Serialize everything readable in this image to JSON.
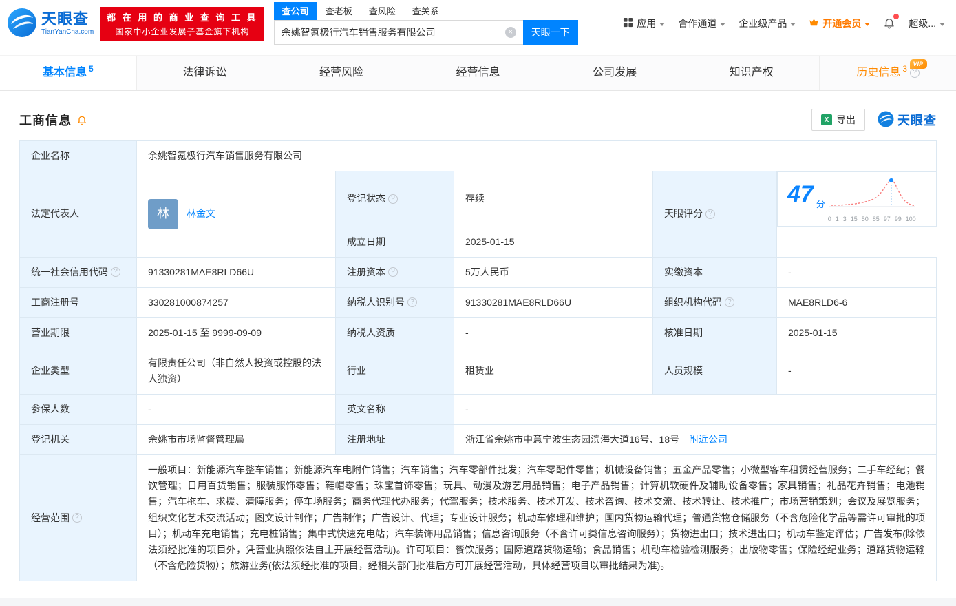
{
  "header": {
    "logo": {
      "title": "天眼查",
      "subtitle": "TianYanCha.com"
    },
    "slogan": {
      "line1": "都 在 用 的 商 业 查 询 工 具",
      "line2": "国家中小企业发展子基金旗下机构"
    },
    "search": {
      "tabs": [
        {
          "label": "查公司"
        },
        {
          "label": "查老板"
        },
        {
          "label": "查风险"
        },
        {
          "label": "查关系"
        }
      ],
      "input_value": "余姚智氪极行汽车销售服务有限公司",
      "button_label": "天眼一下"
    },
    "nav": {
      "apps": "应用",
      "partner": "合作通道",
      "enterprise": "企业级产品",
      "vip": "开通会员",
      "account": "超级..."
    }
  },
  "nav_tabs": [
    {
      "label": "基本信息",
      "count": "5"
    },
    {
      "label": "法律诉讼"
    },
    {
      "label": "经营风险"
    },
    {
      "label": "经营信息"
    },
    {
      "label": "公司发展"
    },
    {
      "label": "知识产权"
    },
    {
      "label": "历史信息",
      "count": "3",
      "vip_tag": "VIP"
    }
  ],
  "section": {
    "title": "工商信息",
    "export_label": "导出",
    "watermark": "天眼查"
  },
  "info": {
    "name_label": "企业名称",
    "name": "余姚智氪极行汽车销售服务有限公司",
    "legal_rep_label": "法定代表人",
    "legal_rep": "林金文",
    "legal_rep_avatar": "林",
    "reg_status_label": "登记状态",
    "reg_status": "存续",
    "score_label": "天眼评分",
    "score": "47",
    "score_unit": "分",
    "established_label": "成立日期",
    "established": "2025-01-15",
    "credit_code_label": "统一社会信用代码",
    "credit_code": "91330281MAE8RLD66U",
    "reg_capital_label": "注册资本",
    "reg_capital": "5万人民币",
    "paid_capital_label": "实缴资本",
    "paid_capital": "-",
    "reg_number_label": "工商注册号",
    "reg_number": "330281000874257",
    "taxpayer_id_label": "纳税人识别号",
    "taxpayer_id": "91330281MAE8RLD66U",
    "org_code_label": "组织机构代码",
    "org_code": "MAE8RLD6-6",
    "business_term_label": "营业期限",
    "business_term": "2025-01-15 至 9999-09-09",
    "taxpayer_quality_label": "纳税人资质",
    "taxpayer_quality": "-",
    "approval_date_label": "核准日期",
    "approval_date": "2025-01-15",
    "company_type_label": "企业类型",
    "company_type": "有限责任公司（非自然人投资或控股的法人独资）",
    "industry_label": "行业",
    "industry": "租赁业",
    "staff_size_label": "人员规模",
    "staff_size": "-",
    "insured_label": "参保人数",
    "insured": "-",
    "english_name_label": "英文名称",
    "english_name": "-",
    "reg_authority_label": "登记机关",
    "reg_authority": "余姚市市场监督管理局",
    "address_label": "注册地址",
    "address": "浙江省余姚市中意宁波生态园滨海大道16号、18号",
    "nearby_link": "附近公司",
    "scope_label": "经营范围",
    "scope": "一般项目：新能源汽车整车销售；新能源汽车电附件销售；汽车销售；汽车零部件批发；汽车零配件零售；机械设备销售；五金产品零售；小微型客车租赁经营服务；二手车经纪；餐饮管理；日用百货销售；服装服饰零售；鞋帽零售；珠宝首饰零售；玩具、动漫及游艺用品销售；电子产品销售；计算机软硬件及辅助设备零售；家具销售；礼品花卉销售；电池销售；汽车拖车、求援、清障服务；停车场服务；商务代理代办服务；代驾服务；技术服务、技术开发、技术咨询、技术交流、技术转让、技术推广；市场营销策划；会议及展览服务；组织文化艺术交流活动；图文设计制作；广告制作；广告设计、代理；专业设计服务；机动车修理和维护；国内货物运输代理；普通货物仓储服务（不含危险化学品等需许可审批的项目）；机动车充电销售；充电桩销售；集中式快速充电站；汽车装饰用品销售；信息咨询服务（不含许可类信息咨询服务）；货物进出口；技术进出口；机动车鉴定评估；广告发布(除依法须经批准的项目外，凭营业执照依法自主开展经营活动)。许可项目：餐饮服务；国际道路货物运输；食品销售；机动车检验检测服务；出版物零售；保险经纪业务；道路货物运输（不含危险货物）；旅游业务(依法须经批准的项目，经相关部门批准后方可开展经营活动，具体经营项目以审批结果为准)。"
  },
  "score_chart": {
    "ticks": [
      "0",
      "1",
      "3",
      "15",
      "50",
      "85",
      "97",
      "99",
      "100"
    ]
  }
}
